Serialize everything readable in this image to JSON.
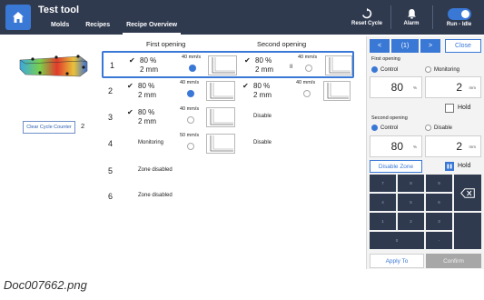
{
  "header": {
    "app_title": "Test tool",
    "tabs": [
      {
        "label": "Molds"
      },
      {
        "label": "Recipes"
      },
      {
        "label": "Recipe Overview",
        "active": true
      }
    ],
    "reset_cycle": "Reset Cycle",
    "alarm": "Alarm",
    "run_idle": "Run - Idle"
  },
  "left": {
    "clear_button": "Clear Cycle Counter",
    "cycle_count": "2"
  },
  "table": {
    "first_opening_header": "First opening",
    "second_opening_header": "Second opening",
    "rows": [
      {
        "num": "1",
        "first": {
          "check": "✔",
          "pct": "80 %",
          "mm": "2 mm",
          "speed": "40 mm/s"
        },
        "second": {
          "check": "✔",
          "pct": "80 %",
          "mm": "2 mm",
          "speed": "40 mm/s",
          "pause": "II"
        }
      },
      {
        "num": "2",
        "first": {
          "check": "✔",
          "pct": "80 %",
          "mm": "2 mm",
          "speed": "40 mm/s"
        },
        "second": {
          "check": "✔",
          "pct": "80 %",
          "mm": "2 mm",
          "speed": "40 mm/s"
        }
      },
      {
        "num": "3",
        "first": {
          "check": "✔",
          "pct": "80 %",
          "mm": "2 mm",
          "speed": "40 mm/s"
        },
        "second_status": "Disable"
      },
      {
        "num": "4",
        "first_status": "Monitoring",
        "first_speed": "50 mm/s",
        "second_status": "Disable"
      },
      {
        "num": "5",
        "status": "Zone disabled"
      },
      {
        "num": "6",
        "status": "Zone disabled"
      }
    ]
  },
  "panel": {
    "prev": "<",
    "index": "(1)",
    "next": ">",
    "close": "Close",
    "first_opening": "First opening",
    "control": "Control",
    "monitoring": "Monitoring",
    "first_pct_value": "80",
    "first_pct_unit": "%",
    "first_mm_value": "2",
    "first_mm_unit": "mm",
    "hold": "Hold",
    "second_opening": "Second opening",
    "disable": "Disable",
    "second_pct_value": "80",
    "second_pct_unit": "%",
    "second_mm_value": "2",
    "second_mm_unit": "mm",
    "disable_zone": "Disable Zone",
    "hold2": "Hold",
    "keys": [
      "7",
      "8",
      "9",
      "4",
      "5",
      "6",
      "1",
      "2",
      "3",
      "0",
      "-"
    ],
    "apply_to": "Apply To",
    "confirm": "Confirm"
  },
  "caption": "Doc007662.png",
  "colors": {
    "header": "#2f3a4f",
    "accent": "#3a78d6"
  }
}
